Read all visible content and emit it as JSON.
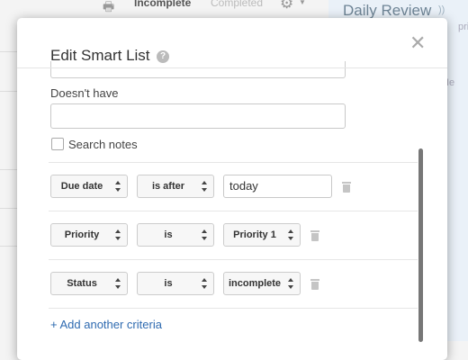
{
  "background": {
    "print_icon": "printer-icon",
    "tab_incomplete": "Incomplete",
    "tab_completed": "Completed",
    "settings_icon": "gear-icon",
    "review_title": "Daily Review",
    "rss_icon": "rss-icon",
    "fragment_1": "pric",
    "fragment_2": "Ie"
  },
  "modal": {
    "title": "Edit Smart List",
    "help_icon": "?",
    "close_icon": "✕",
    "doesnt_have_label": "Doesn't have",
    "doesnt_have_value": "",
    "search_notes_label": "Search notes",
    "search_notes_checked": false,
    "criteria": [
      {
        "field": "Due date",
        "operator": "is after",
        "value": "today",
        "value_type": "text"
      },
      {
        "field": "Priority",
        "operator": "is",
        "value": "Priority 1",
        "value_type": "select"
      },
      {
        "field": "Status",
        "operator": "is",
        "value": "incomplete",
        "value_type": "select"
      }
    ],
    "add_criteria_label": "+ Add another criteria"
  },
  "colors": {
    "link": "#2e6ab0",
    "accent_bg": "#eaf1f8"
  }
}
